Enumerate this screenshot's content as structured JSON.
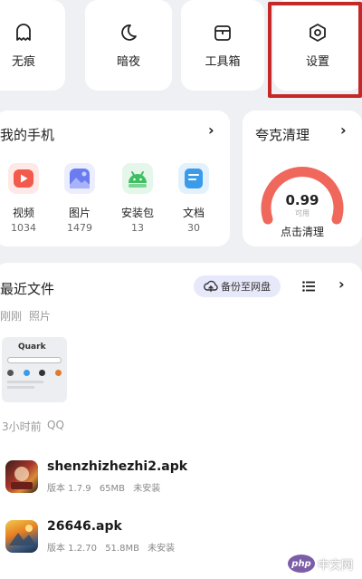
{
  "top_tools": [
    {
      "label": "无痕",
      "icon": "ghost-icon"
    },
    {
      "label": "暗夜",
      "icon": "moon-icon"
    },
    {
      "label": "工具箱",
      "icon": "toolbox-icon"
    },
    {
      "label": "设置",
      "icon": "settings-hexagon-icon"
    }
  ],
  "my_phone": {
    "title": "我的手机",
    "chevron": "›",
    "items": [
      {
        "name": "视频",
        "count": "1034",
        "icon": "video-play-icon",
        "color": "#f25a4b"
      },
      {
        "name": "图片",
        "count": "1479",
        "icon": "image-icon",
        "color": "#6a7cf0"
      },
      {
        "name": "安装包",
        "count": "13",
        "icon": "android-icon",
        "color": "#3fbf62"
      },
      {
        "name": "文档",
        "count": "30",
        "icon": "document-icon",
        "color": "#3a9bea"
      }
    ]
  },
  "cleanup": {
    "title": "夸克清理",
    "chevron": "›",
    "score": "0.99",
    "score_unit": "可用",
    "action": "点击清理",
    "gauge_color": "#f0675c"
  },
  "recent": {
    "title": "最近文件",
    "backup_label": "备份至网盘",
    "chevron": "›",
    "group1": {
      "time": "刚刚",
      "type": "照片"
    },
    "thumb_text": "Quark",
    "group2": {
      "time": "3小时前",
      "type": "QQ"
    },
    "files": [
      {
        "name": "shenzhizhezhi2.apk",
        "version": "版本 1.7.9",
        "size": "65MB",
        "status": "未安装"
      },
      {
        "name": "26646.apk",
        "version": "版本 1.2.70",
        "size": "51.8MB",
        "status": "未安装"
      }
    ]
  },
  "watermark": {
    "logo": "php",
    "text": "中文网"
  },
  "accent_color": "#c62828"
}
